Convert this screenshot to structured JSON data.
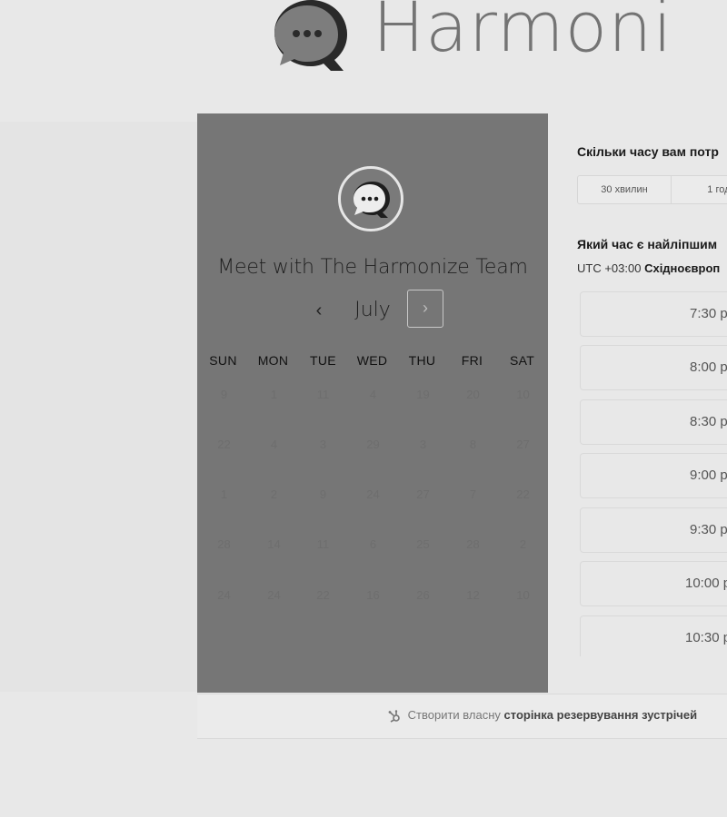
{
  "brand": {
    "name": "Harmoni"
  },
  "calendar": {
    "title": "Meet with The Harmonize Team",
    "month": "July",
    "prev_symbol": "‹",
    "next_symbol": "›",
    "weekdays": [
      "SUN",
      "MON",
      "TUE",
      "WED",
      "THU",
      "FRI",
      "SAT"
    ],
    "weeks": [
      [
        "9",
        "1",
        "11",
        "4",
        "19",
        "20",
        "10"
      ],
      [
        "22",
        "4",
        "3",
        "29",
        "3",
        "8",
        "27"
      ],
      [
        "1",
        "2",
        "9",
        "24",
        "27",
        "7",
        "22"
      ],
      [
        "28",
        "14",
        "11",
        "6",
        "25",
        "28",
        "2"
      ],
      [
        "24",
        "24",
        "22",
        "16",
        "26",
        "12",
        "10"
      ]
    ]
  },
  "booking": {
    "duration_question": "Скільки часу вам потр",
    "durations": [
      "30 хвилин",
      "1 годи"
    ],
    "time_question": "Який час є найліпшим",
    "timezone_prefix": "UTC +03:00",
    "timezone_name": "Східноєвроп",
    "slots": [
      "7:30 p",
      "8:00 p",
      "8:30 p",
      "9:00 p",
      "9:30 p",
      "10:00 p",
      "10:30 p"
    ]
  },
  "footer": {
    "text": "Створити власну",
    "bold": "сторінка резервування зустрічей"
  },
  "colors": {
    "panel": "#767676",
    "background": "#e8e8e8"
  }
}
